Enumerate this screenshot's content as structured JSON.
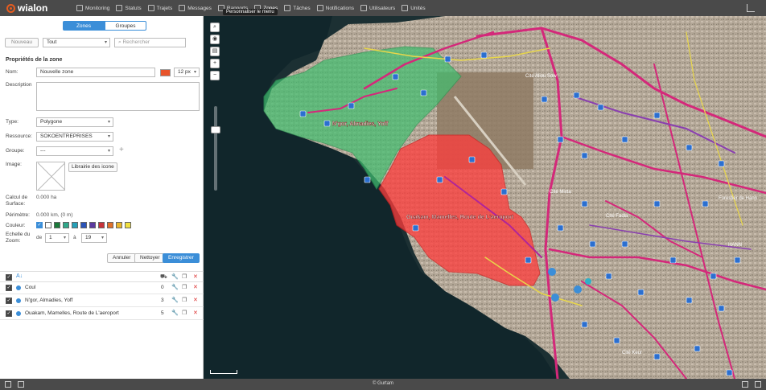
{
  "app": {
    "brand": "wialon",
    "footer": "© Gurtam"
  },
  "nav": [
    {
      "label": "Monitoring",
      "icon": "monitoring-icon"
    },
    {
      "label": "Statuts",
      "icon": "statuts-icon"
    },
    {
      "label": "Trajets",
      "icon": "trajets-icon"
    },
    {
      "label": "Messages",
      "icon": "messages-icon"
    },
    {
      "label": "Rapports",
      "icon": "rapports-icon"
    },
    {
      "label": "Zones",
      "icon": "zones-icon",
      "active": true
    },
    {
      "label": "Tâches",
      "icon": "taches-icon"
    },
    {
      "label": "Notifications",
      "icon": "notifications-icon"
    },
    {
      "label": "Utilisateurs",
      "icon": "utilisateurs-icon"
    },
    {
      "label": "Unités",
      "icon": "unites-icon"
    }
  ],
  "tooltip": "Personnaliser le menu",
  "tabs": {
    "zones": "Zones",
    "groupes": "Groupes"
  },
  "toolbar": {
    "new_label": "Nouveau",
    "filter_value": "Tout",
    "search_placeholder": "Rechercher"
  },
  "form": {
    "title": "Propriétés de la zone",
    "name_label": "Nom:",
    "name_value": "Nouvelle zone",
    "color": "#e8542b",
    "line_width": "12 px",
    "description_label": "Description",
    "type_label": "Type:",
    "type_value": "Polygone",
    "resource_label": "Ressource:",
    "resource_value": "SOKOENTREPRISES",
    "group_label": "Groupe:",
    "group_value": "---",
    "image_label": "Image:",
    "library_button": "Librairie des icone",
    "area_label": "Calcul de Surface:",
    "area_value": "0.000 ha",
    "perimeter_label": "Périmètre:",
    "perimeter_value": "0.000 km, (0 m)",
    "color_label": "Couleur:",
    "palette": [
      "#ffffff",
      "#1a7a3a",
      "#2fa88a",
      "#25a0b8",
      "#2b54b8",
      "#5b3aa0",
      "#c8323a",
      "#e0702a",
      "#e8b52b",
      "#f0e040"
    ],
    "zoom_label": "Echelle du Zoom:",
    "zoom_from_label": "de",
    "zoom_from": "1",
    "zoom_to_label": "à",
    "zoom_to": "19",
    "cancel_button": "Annuler",
    "clear_button": "Nettoyer",
    "save_button": "Enregistrer"
  },
  "list": {
    "sort_icon": "A↓",
    "rows": [
      {
        "name": "Coul",
        "count": "0"
      },
      {
        "name": "N'gor, Almadies, Yoff",
        "count": "3"
      },
      {
        "name": "Ouakam, Mamelles, Route de L'aeroport",
        "count": "5"
      }
    ]
  },
  "map": {
    "zones": [
      {
        "name": "N'gor, Almadies, Yoff",
        "color": "#3fbf6f"
      },
      {
        "name": "Ouakam, Mamelles, Route de L'aeroport",
        "color": "#ff3b3b"
      }
    ],
    "labels": [
      "Cité Aliou Sow",
      "Cité Mixta",
      "Cité Fadia",
      "Cité Keur",
      "Forestier de Hann",
      "HANN"
    ]
  }
}
